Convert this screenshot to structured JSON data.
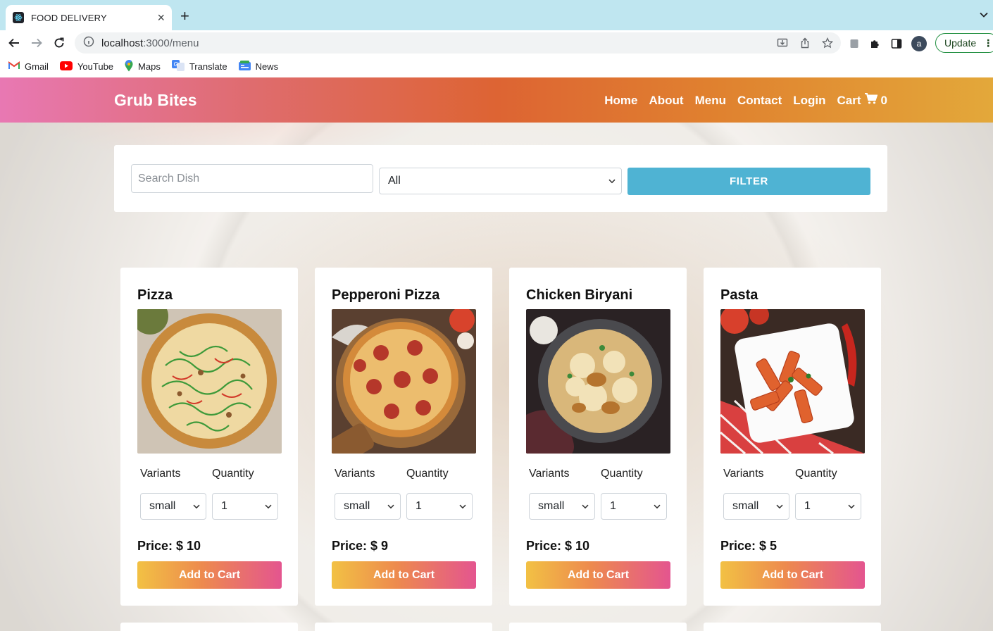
{
  "browser": {
    "tab_title": "FOOD DELIVERY",
    "url_host": "localhost",
    "url_path": ":3000/menu",
    "update_label": "Update",
    "profile_initial": "a",
    "bookmarks": [
      {
        "label": "Gmail",
        "icon": "gmail-icon"
      },
      {
        "label": "YouTube",
        "icon": "youtube-icon"
      },
      {
        "label": "Maps",
        "icon": "maps-icon"
      },
      {
        "label": "Translate",
        "icon": "translate-icon"
      },
      {
        "label": "News",
        "icon": "news-icon"
      }
    ]
  },
  "navbar": {
    "brand": "Grub Bites",
    "links": [
      "Home",
      "About",
      "Menu",
      "Contact",
      "Login"
    ],
    "cart_label": "Cart",
    "cart_count": "0"
  },
  "filter": {
    "search_placeholder": "Search Dish",
    "category_selected": "All",
    "button_label": "FILTER"
  },
  "menu": {
    "variants_label": "Variants",
    "quantity_label": "Quantity",
    "add_label": "Add to Cart",
    "items": [
      {
        "name": "Pizza",
        "variant": "small",
        "quantity": "1",
        "price": "Price: $ 10"
      },
      {
        "name": "Pepperoni Pizza",
        "variant": "small",
        "quantity": "1",
        "price": "Price: $ 9"
      },
      {
        "name": "Chicken Biryani",
        "variant": "small",
        "quantity": "1",
        "price": "Price: $ 10"
      },
      {
        "name": "Pasta",
        "variant": "small",
        "quantity": "1",
        "price": "Price: $ 5"
      }
    ]
  },
  "colors": {
    "navbar_gradient": [
      "#e878b3",
      "#dd6433",
      "#e3a83a"
    ],
    "filter_button": "#4fb3d3",
    "cart_button_gradient": [
      "#f2c144",
      "#e4558f"
    ]
  }
}
